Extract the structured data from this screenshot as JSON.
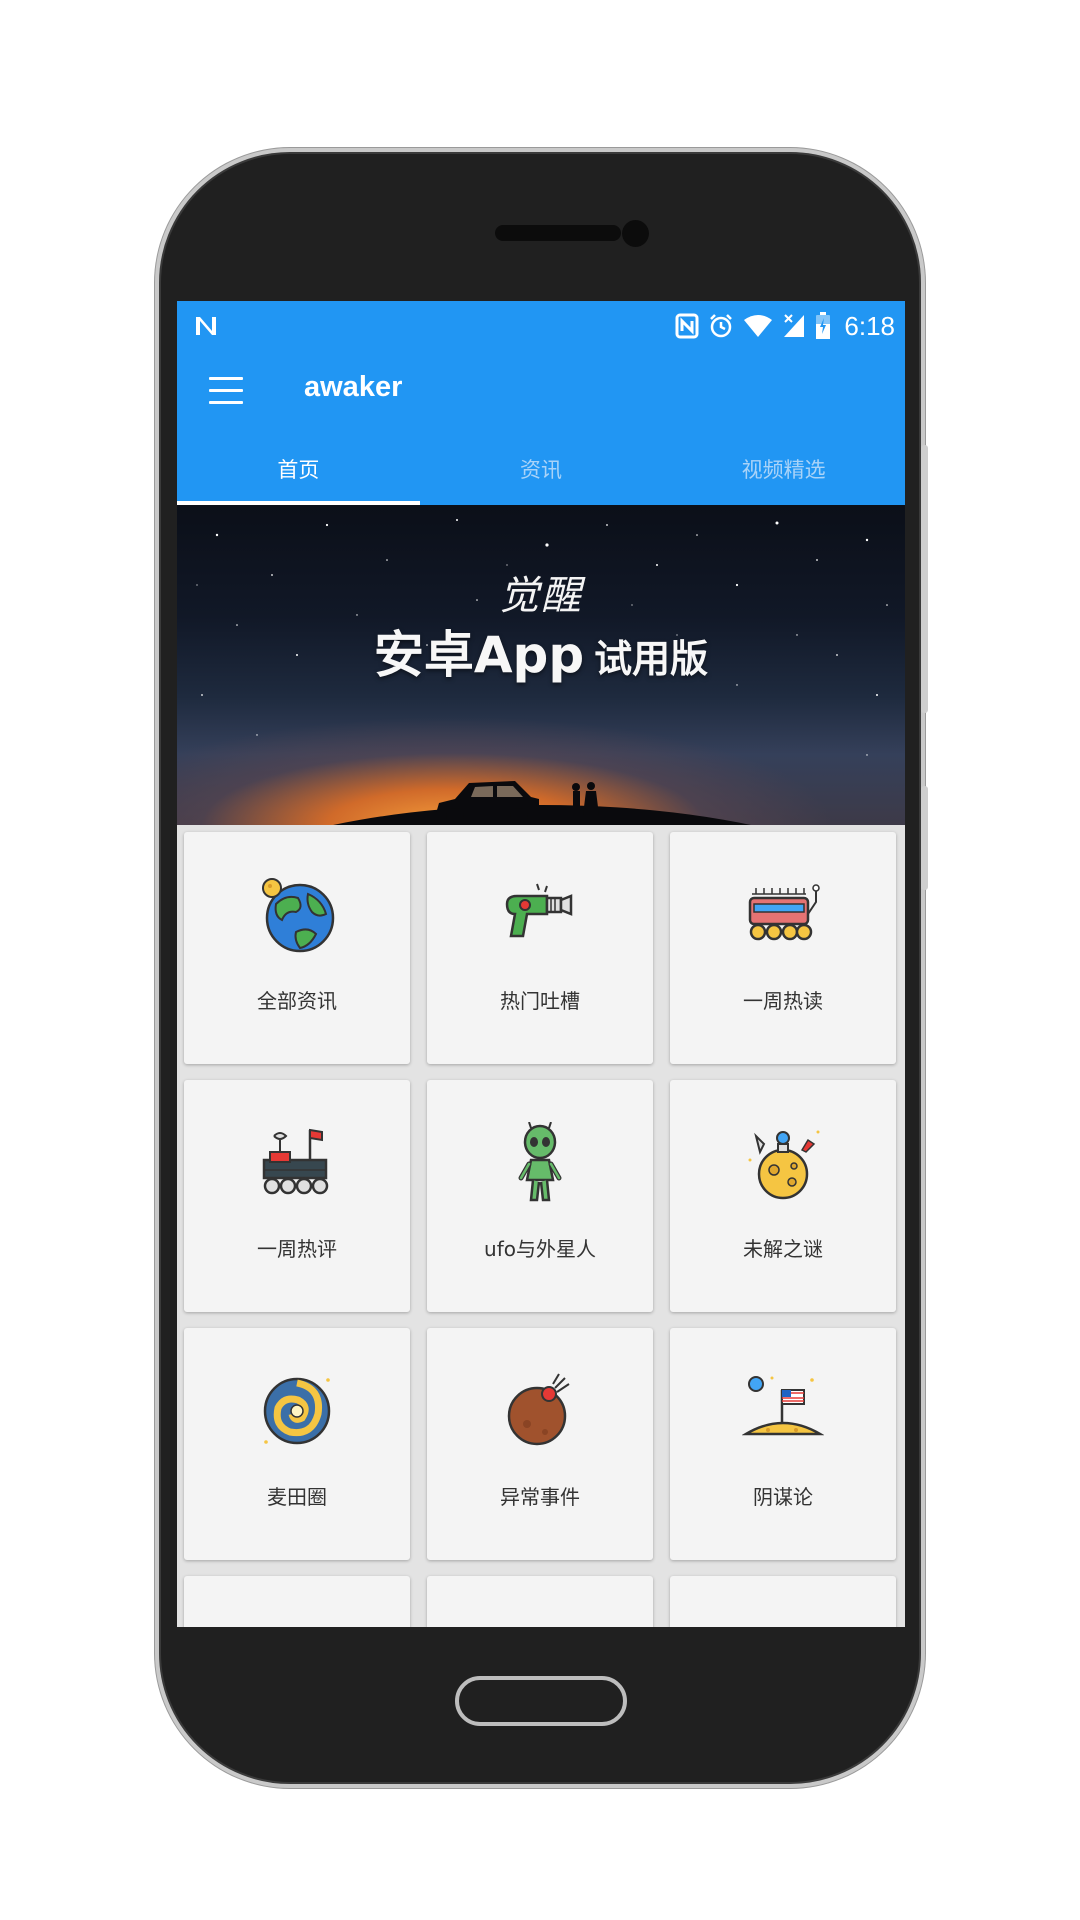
{
  "statusbar": {
    "time": "6:18"
  },
  "appbar": {
    "title": "awaker"
  },
  "tabs": [
    {
      "label": "首页",
      "active": true
    },
    {
      "label": "资讯",
      "active": false
    },
    {
      "label": "视频精选",
      "active": false
    }
  ],
  "banner": {
    "logo_text": "觉醒",
    "title_main": "安卓App",
    "title_sub": "试用版"
  },
  "categories": [
    {
      "label": "全部资讯",
      "icon": "globe-icon"
    },
    {
      "label": "热门吐槽",
      "icon": "ray-gun-icon"
    },
    {
      "label": "一周热读",
      "icon": "moon-rover-icon"
    },
    {
      "label": "一周热评",
      "icon": "mars-rover-icon"
    },
    {
      "label": "ufo与外星人",
      "icon": "alien-icon"
    },
    {
      "label": "未解之谜",
      "icon": "moon-astronaut-icon"
    },
    {
      "label": "麦田圈",
      "icon": "galaxy-icon"
    },
    {
      "label": "异常事件",
      "icon": "meteor-planet-icon"
    },
    {
      "label": "阴谋论",
      "icon": "moon-flag-icon"
    },
    {
      "label": "",
      "icon": ""
    },
    {
      "label": "",
      "icon": ""
    },
    {
      "label": "",
      "icon": ""
    }
  ],
  "colors": {
    "primary": "#2196f3",
    "card": "#f4f4f4",
    "background": "#e3e3e3"
  }
}
